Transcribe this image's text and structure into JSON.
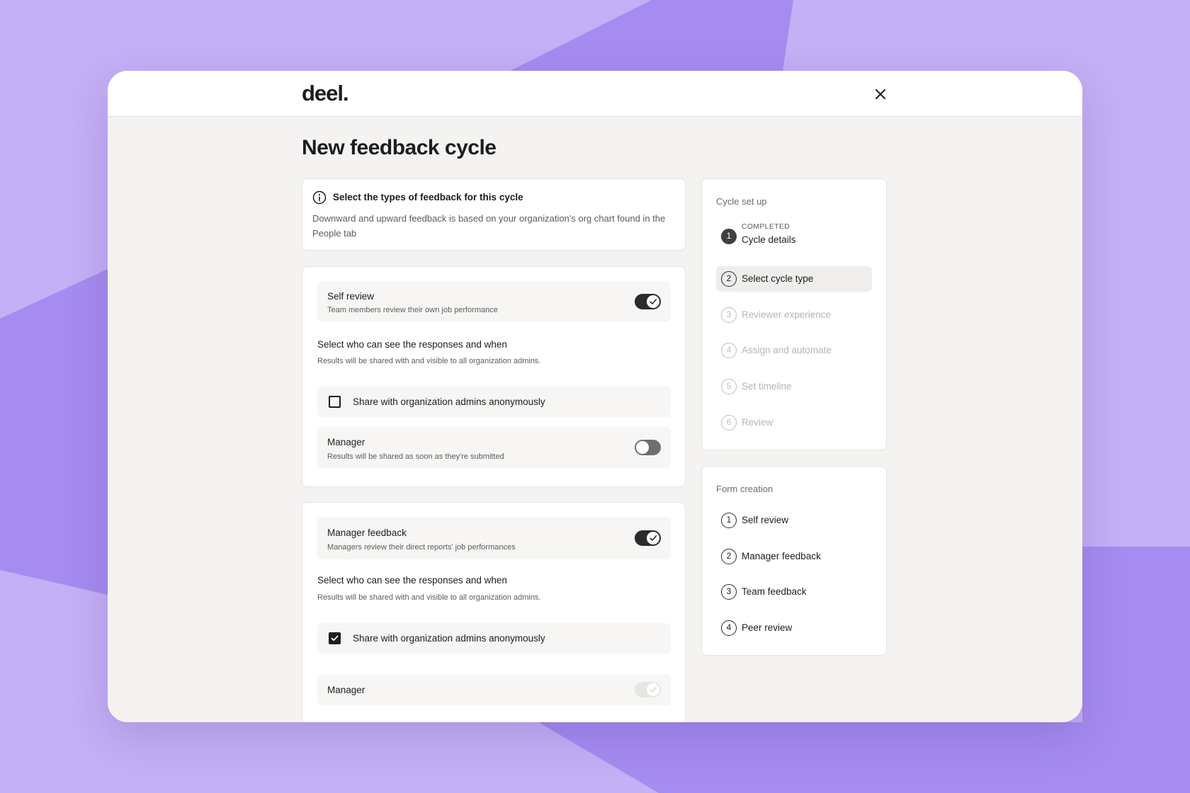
{
  "brand": {
    "logo": "deel."
  },
  "page": {
    "title": "New feedback cycle"
  },
  "info": {
    "title": "Select the types of feedback for this cycle",
    "description": "Downward and upward feedback is based on your organization's org chart found in the People tab"
  },
  "self_review": {
    "title": "Self review",
    "subtitle": "Team members review their own job performance",
    "toggle_on": true,
    "visibility_heading": "Select who can see the responses and when",
    "visibility_note": "Results will be shared with and visible to all organization admins.",
    "share_label": "Share with organization admins anonymously",
    "share_checked": false,
    "manager_title": "Manager",
    "manager_subtitle": "Results will be shared as soon as they're submitted",
    "manager_toggle_on": false
  },
  "manager_feedback": {
    "title": "Manager feedback",
    "subtitle": "Managers review their direct reports' job performances",
    "toggle_on": true,
    "visibility_heading": "Select who can see the responses and when",
    "visibility_note": "Results will be shared with and visible to all organization admins.",
    "share_label": "Share with organization admins anonymously",
    "share_checked": true,
    "manager_title": "Manager",
    "manager_toggle_disabled": true
  },
  "cycle_setup": {
    "heading": "Cycle set up",
    "steps": [
      {
        "num": "1",
        "status": "COMPLETED",
        "label": "Cycle details",
        "state": "done"
      },
      {
        "num": "2",
        "label": "Select cycle type",
        "state": "active"
      },
      {
        "num": "3",
        "label": "Reviewer experience",
        "state": "pending"
      },
      {
        "num": "4",
        "label": "Assign and automate",
        "state": "pending"
      },
      {
        "num": "5",
        "label": "Set timeline",
        "state": "pending"
      },
      {
        "num": "6",
        "label": "Review",
        "state": "pending"
      }
    ]
  },
  "form_creation": {
    "heading": "Form creation",
    "steps": [
      {
        "num": "1",
        "label": "Self review"
      },
      {
        "num": "2",
        "label": "Manager feedback"
      },
      {
        "num": "3",
        "label": "Team feedback"
      },
      {
        "num": "4",
        "label": "Peer review"
      }
    ]
  },
  "colors": {
    "background": "#c4b0f6",
    "shape": "#a68cf0",
    "dark": "#2b2b2b"
  },
  "icons": {
    "close": "close-icon",
    "info": "info-icon",
    "check": "check-icon"
  }
}
